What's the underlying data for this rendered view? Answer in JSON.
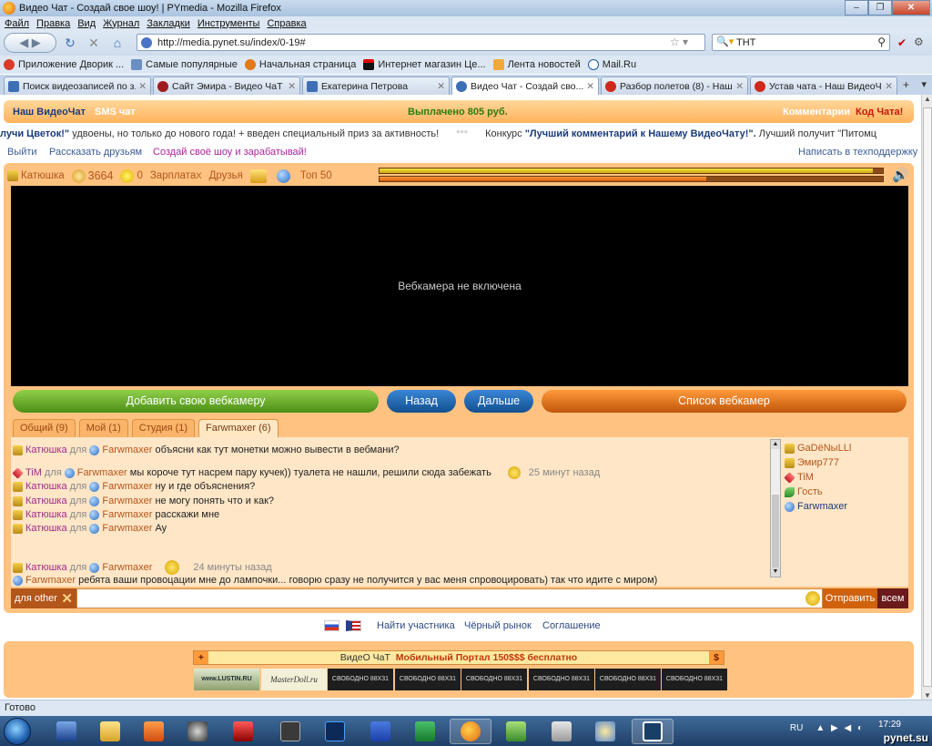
{
  "window": {
    "title": "Видео Чат - Создай свое шоу! | PYmedia - Mozilla Firefox"
  },
  "menu": [
    "Файл",
    "Правка",
    "Вид",
    "Журнал",
    "Закладки",
    "Инструменты",
    "Справка"
  ],
  "url": "http://media.pynet.su/index/0-19#",
  "search": {
    "value": "ТНТ"
  },
  "bookmarks": [
    "Приложение Дворик ...",
    "Самые популярные",
    "Начальная страница",
    "Интернет магазин Це...",
    "Лента новостей",
    "Mail.Ru"
  ],
  "tabs": [
    "Поиск видеозаписей по з...",
    "Сайт Эмира - Видео ЧаТ Э...",
    "Екатерина Петрова",
    "Видео Чат - Создай сво...",
    "Разбор полетов (8) - Наш...",
    "Устав чата - Наш ВидеоЧ..."
  ],
  "site": {
    "brand": "Наш ВидеоЧат",
    "sms": "SMS чат",
    "paid": "Выплачено 805 руб.",
    "comments": "Комментарии",
    "code": "Код Чата!",
    "ticker_bold": "лучи Цветок!\"",
    "ticker_rest": " удвоены, но только до нового года! + введен специальный приз за активность!",
    "ticker_sep": "***",
    "ticker_contest": "Конкурс ",
    "ticker_contest_bold": "\"Лучший комментарий к Нашему ВидеоЧату!\".",
    "ticker_contest_rest": " Лучший получит \"Питомц",
    "link_exit": "Выйти",
    "link_tell": "Рассказать друзьям",
    "link_create": "Создай своё шоу и зарабатывай!",
    "link_support": "Написать в техподдержку"
  },
  "toolbar": {
    "user": "Катюшка",
    "coins": "3664",
    "smiles": "0",
    "salary": "Зарплата",
    "salary_x": "X",
    "friends": "Друзья",
    "top": "Топ 50"
  },
  "progress": {
    "bar1": 0.98,
    "bar2": 0.65
  },
  "video": {
    "status": "Вебкамера не включена"
  },
  "buttons": {
    "add_cam": "Добавить свою вебкамеру",
    "back": "Назад",
    "next": "Дальше",
    "cam_list": "Список вебкамер"
  },
  "chat_tabs": [
    "Общий (9)",
    "Мой (1)",
    "Студия (1)",
    "Farwmaxer (6)"
  ],
  "messages": [
    {
      "from": "Катюшка",
      "to": "Farwmaxer",
      "text": "объясни как тут монетки можно вывести в вебмани?",
      "time": ""
    },
    {
      "from": "TiM",
      "to": "Farwmaxer",
      "text": "мы короче тут насрем пару кучек)) туалета не нашли, решили сюда забежать",
      "time": "25 минут назад"
    },
    {
      "from": "Катюшка",
      "to": "Farwmaxer",
      "text": "ну и где объяснения?",
      "time": ""
    },
    {
      "from": "Катюшка",
      "to": "Farwmaxer",
      "text": "не могу понять что и как?",
      "time": ""
    },
    {
      "from": "Катюшка",
      "to": "Farwmaxer",
      "text": "расскажи мне",
      "time": ""
    },
    {
      "from": "Катюшка",
      "to": "Farwmaxer",
      "text": "Ау",
      "time": ""
    },
    {
      "from": "Катюшка",
      "to": "Farwmaxer",
      "text": "",
      "time": "24 минуты назад"
    },
    {
      "from": "Farwmaxer",
      "to": "",
      "text": "ребята ваши провоцации мне до лампочки... говорю сразу не получится у вас меня спровоцировать) так что идите с миром)",
      "time": ""
    }
  ],
  "chat_for": "для",
  "users": [
    "GaDёNыLLl",
    "Эмир777",
    "TiM",
    "Гость",
    "Farwmaxer"
  ],
  "input": {
    "for_other": "для other",
    "send": "Отправить",
    "all": "всем"
  },
  "footer": {
    "find": "Найти участника",
    "blacklist": "Чёрный рынок",
    "agreement": "Соглашение"
  },
  "banner": {
    "plus": "+",
    "text1": "ВидеО ЧаТ",
    "text2": "Мобильный Портал 150$$$ бесплатно",
    "dollar": "$"
  },
  "ads": [
    "www.LUSTIN.RU",
    "MasterDoll.ru",
    "СВОБОДНО 88X31",
    "СВОБОДНО 88X31",
    "СВОБОДНО 88X31",
    "СВОБОДНО 88X31",
    "СВОБОДНО 88X31",
    "СВОБОДНО 88X31"
  ],
  "status": "Готово",
  "tray": {
    "lang": "RU",
    "time": "17:29",
    "site": "pynet.su"
  }
}
